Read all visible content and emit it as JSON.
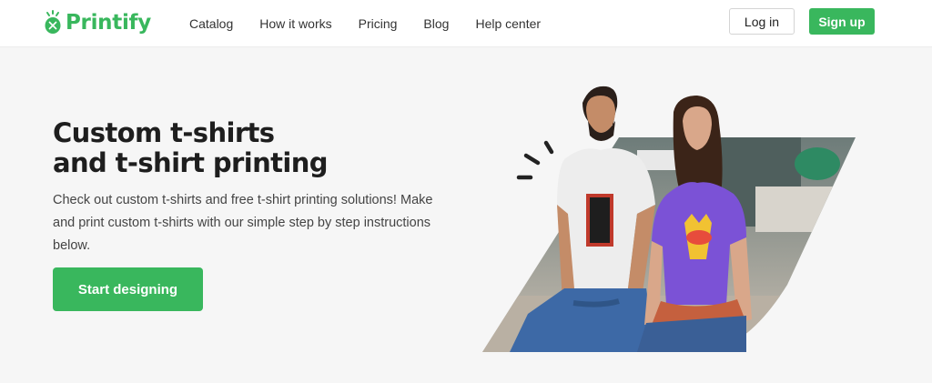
{
  "brand": {
    "name": "Printify",
    "color": "#39b75d",
    "logo_icon": "printify-logo-icon"
  },
  "nav": {
    "items": [
      {
        "label": "Catalog"
      },
      {
        "label": "How it works"
      },
      {
        "label": "Pricing"
      },
      {
        "label": "Blog"
      },
      {
        "label": "Help center"
      }
    ]
  },
  "auth": {
    "login_label": "Log in",
    "signup_label": "Sign up"
  },
  "hero": {
    "title_line1": "Custom t-shirts",
    "title_line2": "and t-shirt printing",
    "description": "Check out custom t-shirts and free t-shirt printing solutions! Make and print custom t-shirts with our simple step by step instructions below.",
    "cta_label": "Start designing",
    "image_description": "hero-photo-two-people-wearing-custom-t-shirts"
  },
  "colors": {
    "accent": "#39b75d",
    "background": "#f6f6f6",
    "header_bg": "#ffffff",
    "text_dark": "#1e1e1e"
  }
}
